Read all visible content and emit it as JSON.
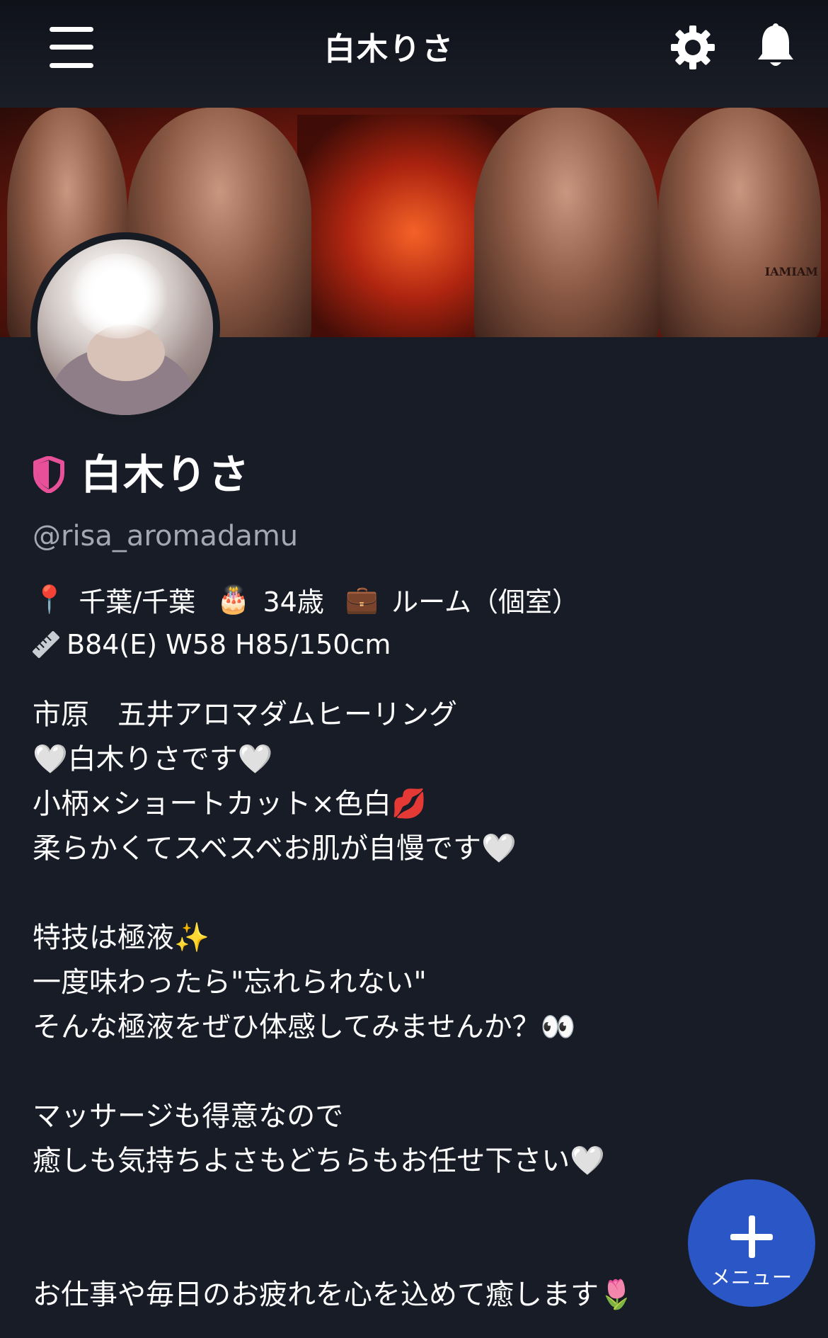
{
  "header": {
    "title": "白木りさ",
    "menu_icon": "hamburger-menu-icon",
    "settings_icon": "gear-icon",
    "notifications_icon": "bell-icon"
  },
  "cover": {
    "brand_text": "IAMIAM"
  },
  "profile": {
    "display_name": "白木りさ",
    "verified_icon": "shield-icon",
    "verified_color": "#e8509a",
    "username": "@risa_aromadamu",
    "location_icon": "📍",
    "location": "千葉/千葉",
    "age_icon": "🎂",
    "age": "34歳",
    "work_icon": "💼",
    "work": "ルーム（個室）",
    "measurements_icon": "ruler-icon",
    "measurements": "B84(E) W58 H85/150cm"
  },
  "bio": {
    "lines": [
      "市原　五井アロマダムヒーリング",
      "🤍白木りさです🤍",
      "小柄×ショートカット×色白💋",
      "柔らかくてスベスベお肌が自慢です🤍",
      "",
      "特技は極液✨",
      "一度味わったら\"忘れられない\"",
      "そんな極液をぜひ体感してみませんか？👀",
      "",
      "マッサージも得意なので",
      "癒しも気持ちよさもどちらもお任せ下さい🤍",
      "",
      "",
      "お仕事や毎日のお疲れを心を込めて癒します🌷"
    ]
  },
  "fab": {
    "label": "メニュー",
    "icon": "plus-icon",
    "color": "#2a56c6"
  },
  "colors": {
    "background": "#181c26",
    "text": "#ffffff",
    "muted_text": "#a4a8b2"
  }
}
